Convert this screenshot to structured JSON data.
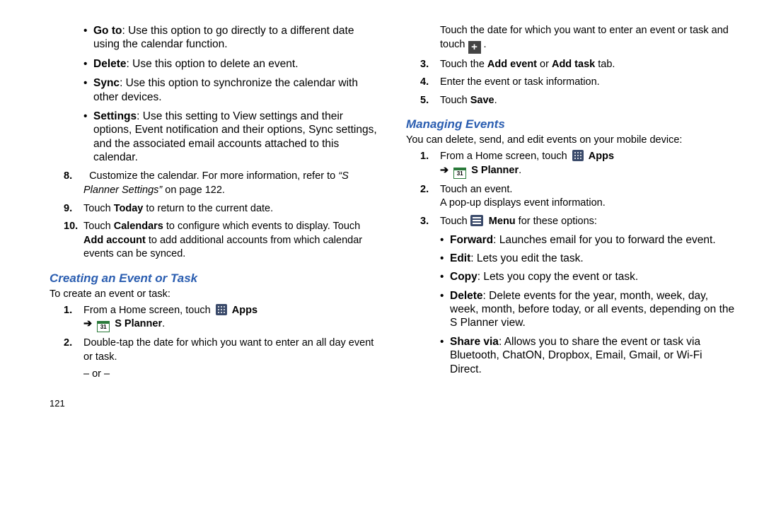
{
  "col1": {
    "bullets": [
      {
        "bold": "Go to",
        "text": ": Use this option to go directly to a different date using the calendar function."
      },
      {
        "bold": "Delete",
        "text": ": Use this option to delete an event."
      },
      {
        "bold": "Sync",
        "text": ": Use this option to synchronize the calendar with other devices."
      },
      {
        "bold": "Settings",
        "text": ": Use this setting to View settings and their options, Event notification and their options, Sync settings, and the associated email accounts attached to this calendar."
      }
    ],
    "step8_pre": "Customize the calendar. For more information, refer to ",
    "step8_ref": "“S Planner Settings”",
    "step8_post": " on page 122.",
    "step9_a": "Touch ",
    "step9_b": "Today",
    "step9_c": " to return to the current date.",
    "step10_a": "Touch ",
    "step10_b": "Calendars",
    "step10_c": " to configure which events to display. Touch ",
    "step10_d": "Add account",
    "step10_e": " to add additional accounts from which calendar events can be synced.",
    "heading": "Creating an Event or Task",
    "intro": "To create an event or task:",
    "c_step1_a": "From a Home screen, touch ",
    "c_step1_apps": "Apps",
    "c_step1_arrow": "➔",
    "c_step1_planner_num": "31",
    "c_step1_planner": "S Planner",
    "c_step1_period": ".",
    "c_step2": "Double-tap the date for which you want to enter an all day event or task.",
    "or": "– or –",
    "page_num": "121"
  },
  "col2": {
    "top_a": "Touch the date for which you want to enter an event or task and touch ",
    "top_post": ".",
    "s3_a": "Touch the ",
    "s3_b": "Add event",
    "s3_c": " or ",
    "s3_d": "Add task",
    "s3_e": "  tab.",
    "s4": "Enter the event or task information.",
    "s5_a": "Touch ",
    "s5_b": "Save",
    "s5_c": ".",
    "heading": "Managing Events",
    "intro": "You can delete, send, and edit events on your mobile device:",
    "m1_a": "From a Home screen, touch ",
    "m1_apps": "Apps",
    "m1_arrow": "➔",
    "m1_planner_num": "31",
    "m1_planner": "S Planner",
    "m1_period": ".",
    "m2_a": "Touch an event.",
    "m2_b": "A pop-up displays event information.",
    "m3_a": "Touch ",
    "m3_menu": "Menu",
    "m3_b": " for these options:",
    "bullets": [
      {
        "bold": "Forward",
        "text": ": Launches email for you to forward the event."
      },
      {
        "bold": "Edit",
        "text": ": Lets you edit the task."
      },
      {
        "bold": "Copy",
        "text": ": Lets you copy the event or task."
      },
      {
        "bold": "Delete",
        "text": ": Delete events for the year, month, week, day, week, month, before today, or all events, depending on the S Planner view."
      },
      {
        "bold": "Share via",
        "text": ": Allows you to share the event or task via Bluetooth, ChatON, Dropbox, Email, Gmail, or Wi-Fi Direct."
      }
    ]
  }
}
